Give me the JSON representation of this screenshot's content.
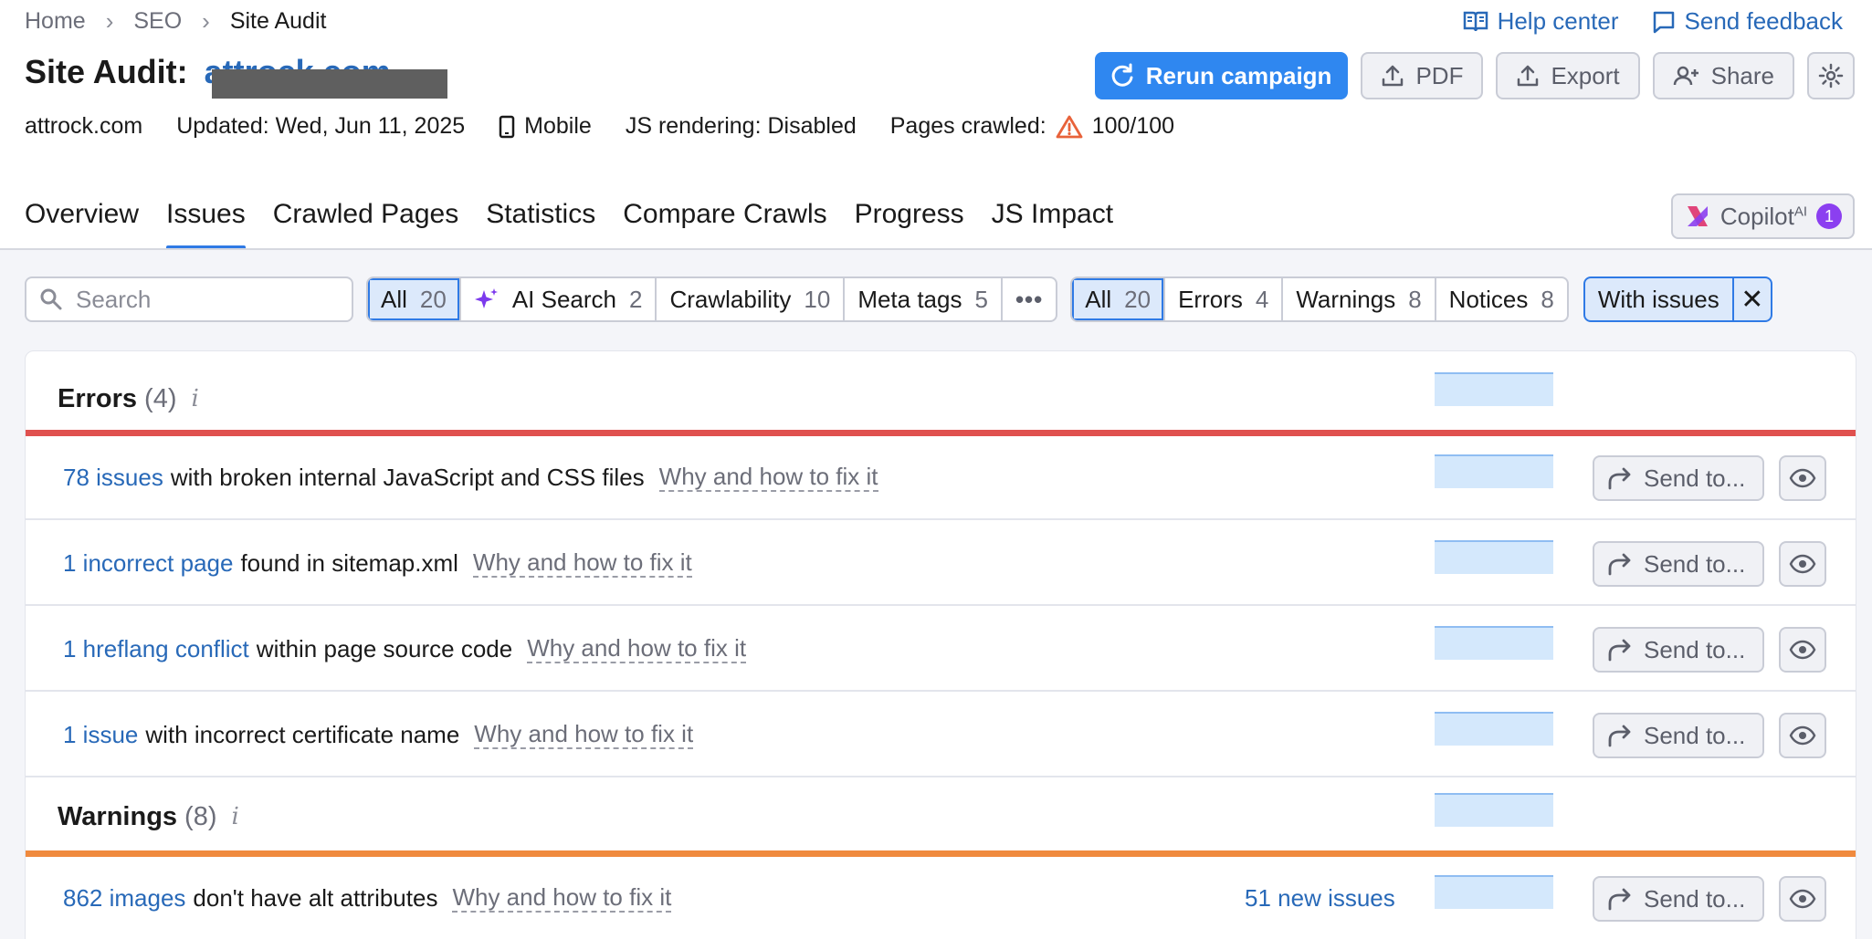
{
  "breadcrumb": [
    "Home",
    "SEO",
    "Site Audit"
  ],
  "toplinks": {
    "help": "Help center",
    "feedback": "Send feedback"
  },
  "title": {
    "label": "Site Audit:",
    "domain": "attrock.com"
  },
  "actions": {
    "rerun": "Rerun campaign",
    "pdf": "PDF",
    "export": "Export",
    "share": "Share"
  },
  "meta": {
    "site": "attrock.com",
    "updated": "Updated: Wed, Jun 11, 2025",
    "device": "Mobile",
    "js": "JS rendering: Disabled",
    "pages_label": "Pages crawled:",
    "pages_value": "100/100"
  },
  "tabs": [
    "Overview",
    "Issues",
    "Crawled Pages",
    "Statistics",
    "Compare Crawls",
    "Progress",
    "JS Impact"
  ],
  "copilot": {
    "label": "Copilot",
    "sup": "AI",
    "badge": "1"
  },
  "search": {
    "placeholder": "Search"
  },
  "category_filters": [
    {
      "label": "All",
      "count": "20"
    },
    {
      "label": "AI Search",
      "count": "2"
    },
    {
      "label": "Crawlability",
      "count": "10"
    },
    {
      "label": "Meta tags",
      "count": "5"
    },
    {
      "label": "•••",
      "count": ""
    }
  ],
  "type_filters": [
    {
      "label": "All",
      "count": "20"
    },
    {
      "label": "Errors",
      "count": "4"
    },
    {
      "label": "Warnings",
      "count": "8"
    },
    {
      "label": "Notices",
      "count": "8"
    }
  ],
  "with_issues": {
    "label": "With issues",
    "close": "✕"
  },
  "sections": {
    "errors": {
      "title": "Errors",
      "count": "(4)",
      "info": "i",
      "color": "#e0514f"
    },
    "warnings": {
      "title": "Warnings",
      "count": "(8)",
      "info": "i",
      "color": "#f08a3e"
    }
  },
  "send_to": "Send to...",
  "why": "Why and how to fix it",
  "errors": [
    {
      "link": "78 issues",
      "text": "with broken internal JavaScript and CSS files"
    },
    {
      "link": "1 incorrect page",
      "text": "found in sitemap.xml"
    },
    {
      "link": "1 hreflang conflict",
      "text": "within page source code"
    },
    {
      "link": "1 issue",
      "text": "with incorrect certificate name"
    }
  ],
  "warnings": [
    {
      "link": "862 images",
      "text": "don't have alt attributes",
      "new": "51 new issues"
    }
  ]
}
